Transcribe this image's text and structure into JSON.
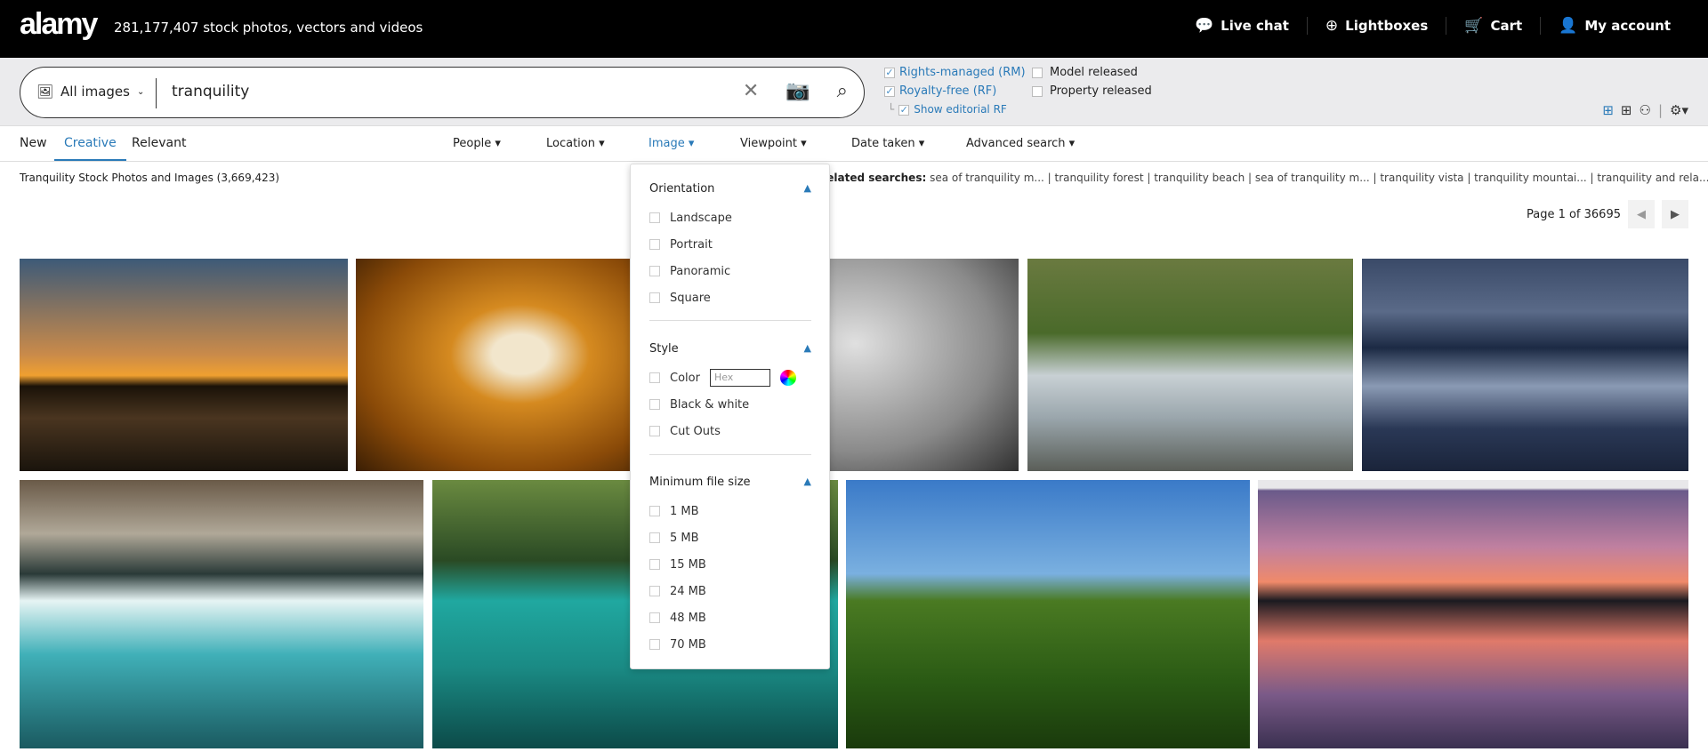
{
  "header": {
    "logo": "alamy",
    "tagline": "281,177,407 stock photos, vectors and videos",
    "nav": [
      {
        "label": "Live chat",
        "icon": "chat-icon"
      },
      {
        "label": "Lightboxes",
        "icon": "plus-circle-icon"
      },
      {
        "label": "Cart",
        "icon": "cart-icon"
      },
      {
        "label": "My account",
        "icon": "user-icon"
      }
    ]
  },
  "search": {
    "category": "All images",
    "query": "tranquility"
  },
  "filters": {
    "rights_managed": "Rights-managed (RM)",
    "royalty_free": "Royalty-free (RF)",
    "show_editorial": "Show editorial RF",
    "model_released": "Model released",
    "property_released": "Property released"
  },
  "tabs": [
    "New",
    "Creative",
    "Relevant"
  ],
  "active_tab": "Creative",
  "menus": [
    "People",
    "Location",
    "Image",
    "Viewpoint",
    "Date taken",
    "Advanced search"
  ],
  "active_menu": "Image",
  "results": {
    "title": "Tranquility Stock Photos and Images (3,669,423)",
    "related_label": "Related searches:",
    "related": "sea of tranquility m... | tranquility forest | tranquility beach | sea of tranquility m... | tranquility vista | tranquility mountai... | tranquility and rela..."
  },
  "pager": {
    "text": "Page 1 of 36695"
  },
  "dropdown": {
    "orientation": {
      "title": "Orientation",
      "options": [
        "Landscape",
        "Portrait",
        "Panoramic",
        "Square"
      ]
    },
    "style": {
      "title": "Style",
      "color": "Color",
      "hex_placeholder": "Hex",
      "options": [
        "Black & white",
        "Cut Outs"
      ]
    },
    "filesize": {
      "title": "Minimum file size",
      "options": [
        "1 MB",
        "5 MB",
        "15 MB",
        "24 MB",
        "48 MB",
        "70 MB"
      ]
    }
  },
  "accent": "#2a7ab8"
}
